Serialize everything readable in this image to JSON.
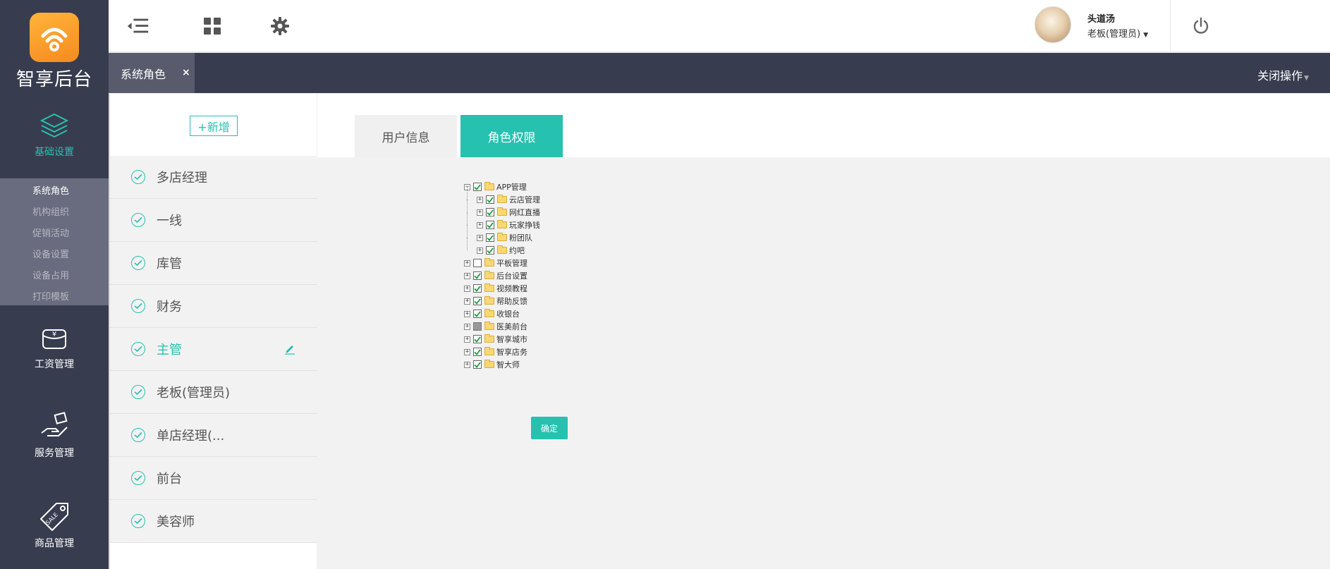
{
  "app": {
    "logo_text": "智享后台"
  },
  "sidebar": {
    "sections": [
      {
        "label": "基础设置",
        "icon": "layers-icon"
      },
      {
        "label": "工资管理",
        "icon": "wallet-icon"
      },
      {
        "label": "服务管理",
        "icon": "hand-service-icon"
      },
      {
        "label": "商品管理",
        "icon": "sale-tag-icon"
      }
    ],
    "submenu": [
      "系统角色",
      "机构组织",
      "促销活动",
      "设备设置",
      "设备占用",
      "打印模板"
    ]
  },
  "header": {
    "user_name": "头道汤",
    "user_role": "老板(管理员)"
  },
  "tabbar": {
    "active_tab": "系统角色",
    "close_symbol": "×",
    "close_ops": "关闭操作"
  },
  "roles": {
    "add_label": "+新增",
    "items": [
      "多店经理",
      "一线",
      "库管",
      "财务",
      "主管",
      "老板(管理员)",
      "单店经理(...",
      "前台",
      "美容师"
    ],
    "active_index": 4
  },
  "content": {
    "tabs": [
      "用户信息",
      "角色权限"
    ],
    "active_tab": 1,
    "tree": [
      {
        "label": "APP管理",
        "level": 0,
        "expander": "−",
        "state": "checked"
      },
      {
        "label": "云店管理",
        "level": 1,
        "expander": "+",
        "state": "checked"
      },
      {
        "label": "网红直播",
        "level": 1,
        "expander": "+",
        "state": "checked"
      },
      {
        "label": "玩家挣钱",
        "level": 1,
        "expander": "+",
        "state": "checked"
      },
      {
        "label": "粉团队",
        "level": 1,
        "expander": "+",
        "state": "checked"
      },
      {
        "label": "约吧",
        "level": 1,
        "expander": "+",
        "state": "checked"
      },
      {
        "label": "平板管理",
        "level": 0,
        "expander": "+",
        "state": "unchecked"
      },
      {
        "label": "后台设置",
        "level": 0,
        "expander": "+",
        "state": "checked"
      },
      {
        "label": "视频教程",
        "level": 0,
        "expander": "+",
        "state": "checked"
      },
      {
        "label": "帮助反馈",
        "level": 0,
        "expander": "+",
        "state": "checked"
      },
      {
        "label": "收银台",
        "level": 0,
        "expander": "+",
        "state": "checked"
      },
      {
        "label": "医美前台",
        "level": 0,
        "expander": "+",
        "state": "partial"
      },
      {
        "label": "智享城市",
        "level": 0,
        "expander": "+",
        "state": "checked"
      },
      {
        "label": "智享店务",
        "level": 0,
        "expander": "+",
        "state": "checked"
      },
      {
        "label": "智大师",
        "level": 0,
        "expander": "+",
        "state": "checked"
      }
    ],
    "confirm_label": "确定"
  },
  "colors": {
    "accent": "#27c1b0",
    "nav_bg": "#383c4f",
    "submenu_bg": "#696c7e"
  }
}
